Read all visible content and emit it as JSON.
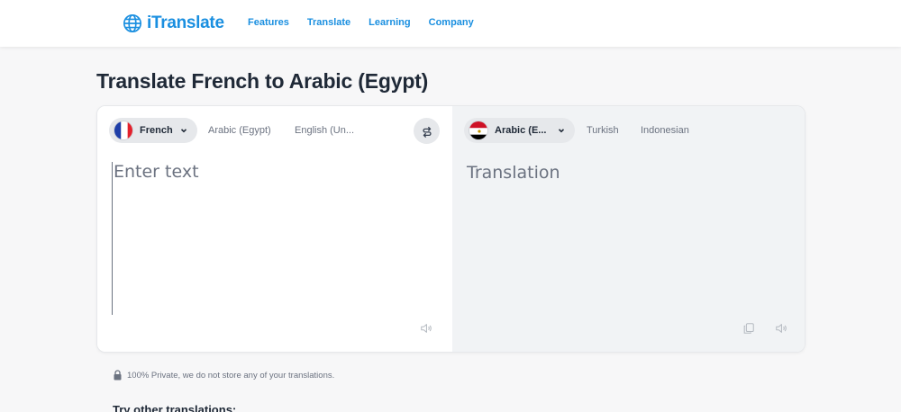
{
  "brand": {
    "name": "iTranslate",
    "color": "#1a8fe0"
  },
  "nav": {
    "items": [
      {
        "label": "Features"
      },
      {
        "label": "Translate"
      },
      {
        "label": "Learning"
      },
      {
        "label": "Company"
      }
    ]
  },
  "page_title": "Translate French to Arabic (Egypt)",
  "source": {
    "selected_language": "French",
    "flag": "france-flag-icon",
    "quick_options": [
      "Arabic (Egypt)",
      "English (Un..."
    ],
    "placeholder": "Enter text",
    "value": ""
  },
  "target": {
    "selected_language": "Arabic (E...",
    "flag": "egypt-flag-icon",
    "quick_options": [
      "Turkish",
      "Indonesian"
    ],
    "placeholder": "Translation"
  },
  "icons": {
    "swap": "swap-icon",
    "speaker": "speaker-icon",
    "copy": "copy-icon",
    "lock": "lock-icon",
    "chevron": "chevron-down-icon"
  },
  "privacy_note": "100% Private, we do not store any of your translations.",
  "other_translations_heading": "Try other translations:"
}
